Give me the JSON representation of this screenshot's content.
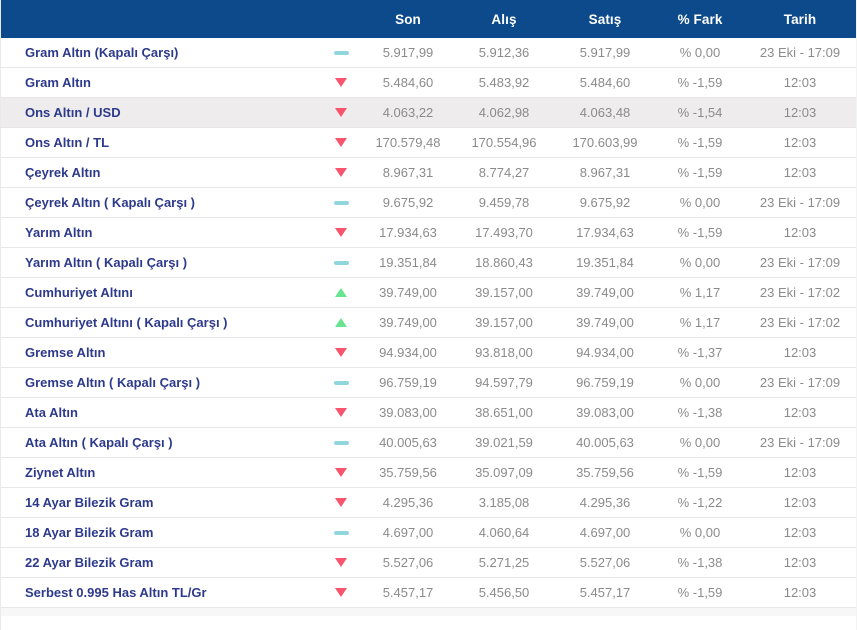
{
  "table": {
    "columns": {
      "son": "Son",
      "alis": "Alış",
      "satis": "Satış",
      "fark": "% Fark",
      "tarih": "Tarih"
    },
    "rows": [
      {
        "name": "Gram Altın (Kapalı Çarşı)",
        "trend": "flat",
        "son": "5.917,99",
        "alis": "5.912,36",
        "satis": "5.917,99",
        "fark": "% 0,00",
        "tarih": "23 Eki - 17:09",
        "highlighted": false
      },
      {
        "name": "Gram Altın",
        "trend": "down",
        "son": "5.484,60",
        "alis": "5.483,92",
        "satis": "5.484,60",
        "fark": "% -1,59",
        "tarih": "12:03",
        "highlighted": false
      },
      {
        "name": "Ons Altın / USD",
        "trend": "down",
        "son": "4.063,22",
        "alis": "4.062,98",
        "satis": "4.063,48",
        "fark": "% -1,54",
        "tarih": "12:03",
        "highlighted": true
      },
      {
        "name": "Ons Altın / TL",
        "trend": "down",
        "son": "170.579,48",
        "alis": "170.554,96",
        "satis": "170.603,99",
        "fark": "% -1,59",
        "tarih": "12:03",
        "highlighted": false
      },
      {
        "name": "Çeyrek Altın",
        "trend": "down",
        "son": "8.967,31",
        "alis": "8.774,27",
        "satis": "8.967,31",
        "fark": "% -1,59",
        "tarih": "12:03",
        "highlighted": false
      },
      {
        "name": "Çeyrek Altın ( Kapalı Çarşı )",
        "trend": "flat",
        "son": "9.675,92",
        "alis": "9.459,78",
        "satis": "9.675,92",
        "fark": "% 0,00",
        "tarih": "23 Eki - 17:09",
        "highlighted": false
      },
      {
        "name": "Yarım Altın",
        "trend": "down",
        "son": "17.934,63",
        "alis": "17.493,70",
        "satis": "17.934,63",
        "fark": "% -1,59",
        "tarih": "12:03",
        "highlighted": false
      },
      {
        "name": "Yarım Altın ( Kapalı Çarşı )",
        "trend": "flat",
        "son": "19.351,84",
        "alis": "18.860,43",
        "satis": "19.351,84",
        "fark": "% 0,00",
        "tarih": "23 Eki - 17:09",
        "highlighted": false
      },
      {
        "name": "Cumhuriyet Altını",
        "trend": "up",
        "son": "39.749,00",
        "alis": "39.157,00",
        "satis": "39.749,00",
        "fark": "% 1,17",
        "tarih": "23 Eki - 17:02",
        "highlighted": false
      },
      {
        "name": "Cumhuriyet Altını ( Kapalı Çarşı )",
        "trend": "up",
        "son": "39.749,00",
        "alis": "39.157,00",
        "satis": "39.749,00",
        "fark": "% 1,17",
        "tarih": "23 Eki - 17:02",
        "highlighted": false
      },
      {
        "name": "Gremse Altın",
        "trend": "down",
        "son": "94.934,00",
        "alis": "93.818,00",
        "satis": "94.934,00",
        "fark": "% -1,37",
        "tarih": "12:03",
        "highlighted": false
      },
      {
        "name": "Gremse Altın ( Kapalı Çarşı )",
        "trend": "flat",
        "son": "96.759,19",
        "alis": "94.597,79",
        "satis": "96.759,19",
        "fark": "% 0,00",
        "tarih": "23 Eki - 17:09",
        "highlighted": false
      },
      {
        "name": "Ata Altın",
        "trend": "down",
        "son": "39.083,00",
        "alis": "38.651,00",
        "satis": "39.083,00",
        "fark": "% -1,38",
        "tarih": "12:03",
        "highlighted": false
      },
      {
        "name": "Ata Altın ( Kapalı Çarşı )",
        "trend": "flat",
        "son": "40.005,63",
        "alis": "39.021,59",
        "satis": "40.005,63",
        "fark": "% 0,00",
        "tarih": "23 Eki - 17:09",
        "highlighted": false
      },
      {
        "name": "Ziynet Altın",
        "trend": "down",
        "son": "35.759,56",
        "alis": "35.097,09",
        "satis": "35.759,56",
        "fark": "% -1,59",
        "tarih": "12:03",
        "highlighted": false
      },
      {
        "name": "14 Ayar Bilezik Gram",
        "trend": "down",
        "son": "4.295,36",
        "alis": "3.185,08",
        "satis": "4.295,36",
        "fark": "% -1,22",
        "tarih": "12:03",
        "highlighted": false
      },
      {
        "name": "18 Ayar Bilezik Gram",
        "trend": "flat",
        "son": "4.697,00",
        "alis": "4.060,64",
        "satis": "4.697,00",
        "fark": "% 0,00",
        "tarih": "12:03",
        "highlighted": false
      },
      {
        "name": "22 Ayar Bilezik Gram",
        "trend": "down",
        "son": "5.527,06",
        "alis": "5.271,25",
        "satis": "5.527,06",
        "fark": "% -1,38",
        "tarih": "12:03",
        "highlighted": false
      },
      {
        "name": "Serbest 0.995 Has Altın TL/Gr",
        "trend": "down",
        "son": "5.457,17",
        "alis": "5.456,50",
        "satis": "5.457,17",
        "fark": "% -1,59",
        "tarih": "12:03",
        "highlighted": false
      }
    ]
  },
  "colors": {
    "header_bg": "#0d4a8c",
    "label": "#2d3a8c",
    "value": "#8b8b8b",
    "highlight_row_bg": "#eeecec",
    "trend_down": "#f9536e",
    "trend_up": "#67e48f",
    "trend_flat": "#8fd6df"
  }
}
